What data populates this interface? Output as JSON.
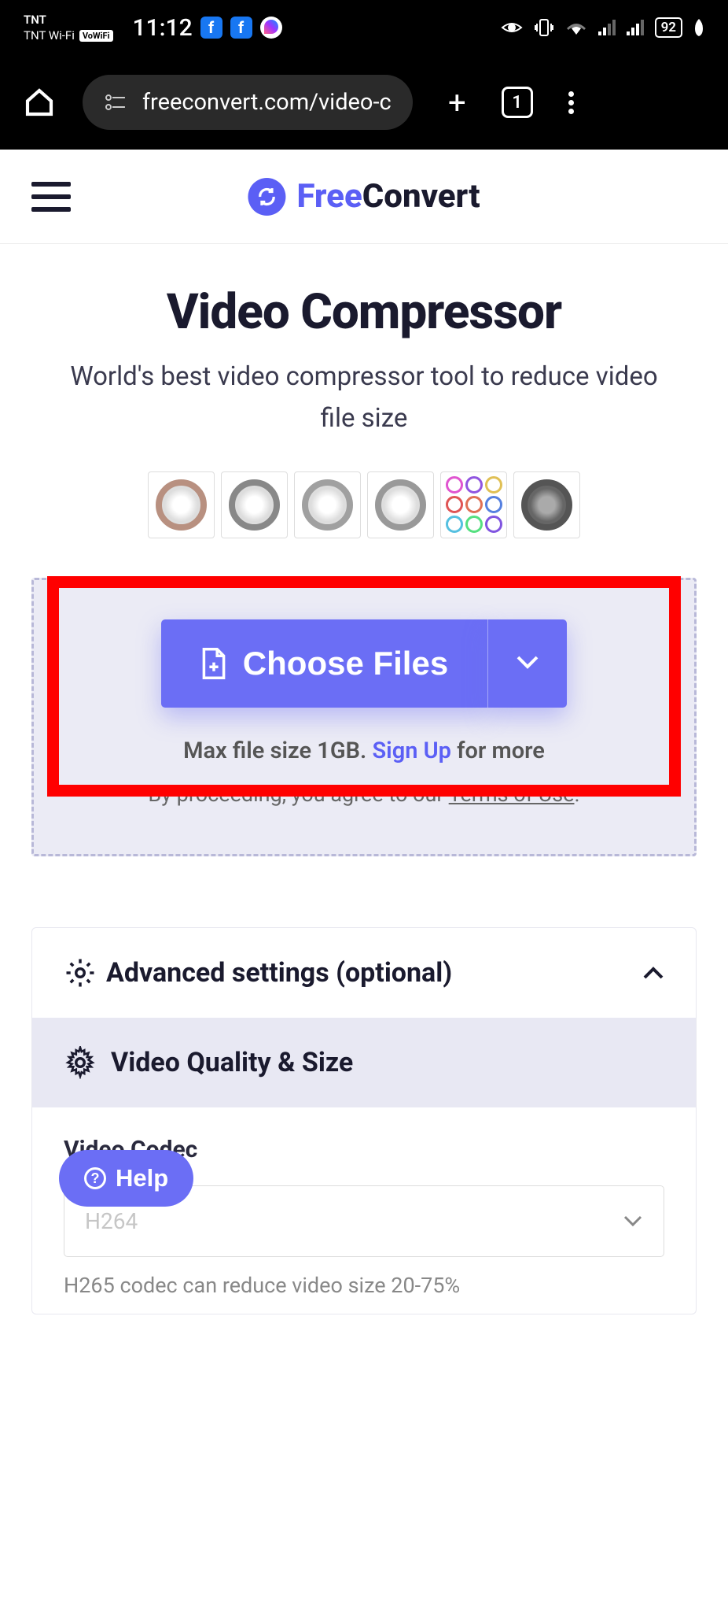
{
  "status_bar": {
    "carrier": "TNT",
    "wifi_label": "TNT Wi-Fi",
    "vowifi": "VoWiFi",
    "time": "11:12",
    "battery": "92"
  },
  "browser": {
    "url": "freeconvert.com/video-c",
    "tab_count": "1"
  },
  "logo": {
    "free": "Free",
    "convert": "Convert"
  },
  "page": {
    "title": "Video Compressor",
    "subtitle": "World's best video compressor tool to reduce video file size"
  },
  "upload": {
    "choose_files": "Choose Files",
    "max_size_prefix": "Max file size 1GB. ",
    "signup": "Sign Up",
    "max_size_suffix": " for more",
    "proceed_prefix": "By proceeding, you agree to our ",
    "terms": "Terms of Use",
    "proceed_suffix": "."
  },
  "settings": {
    "advanced_title": "Advanced settings (optional)",
    "quality_title": "Video Quality & Size",
    "codec_label": "Video Codec",
    "codec_value": "H264",
    "codec_hint": "H265 codec can reduce video size 20-75%"
  },
  "help": {
    "label": "Help"
  }
}
